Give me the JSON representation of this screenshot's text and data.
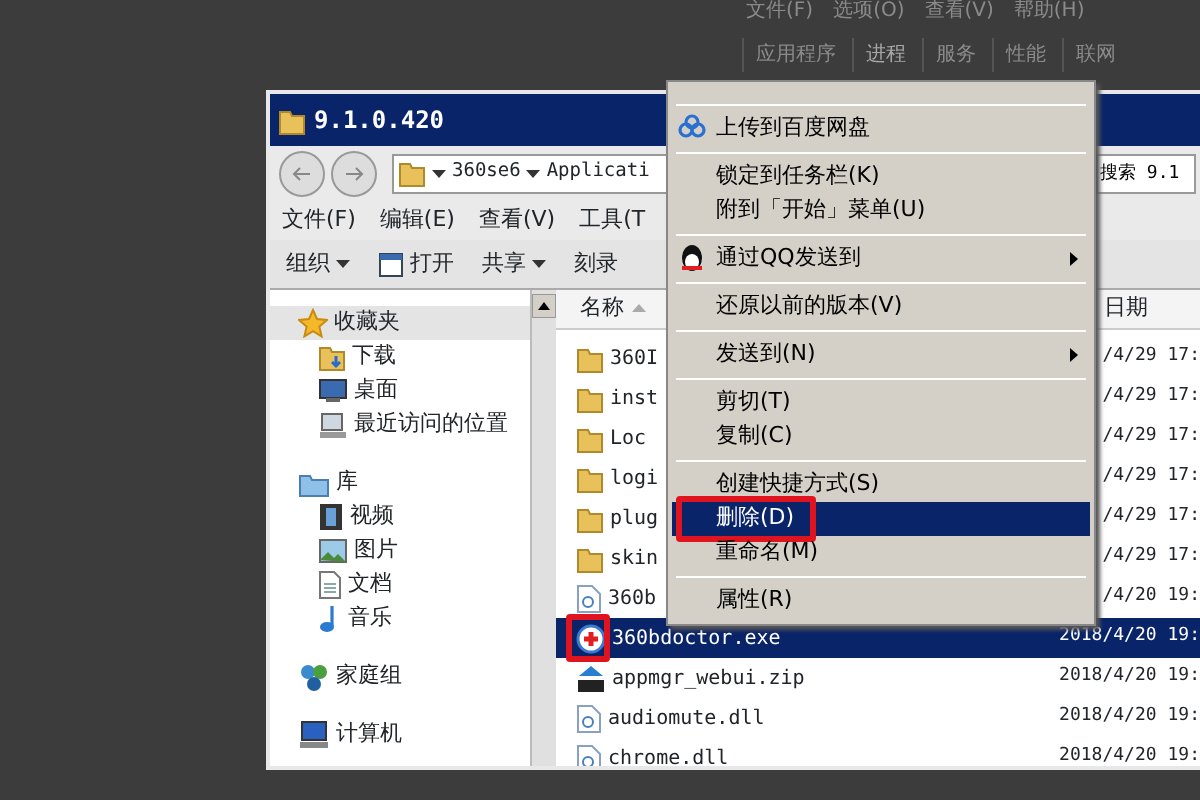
{
  "background_window": {
    "menu": [
      "文件(F)",
      "选项(O)",
      "查看(V)",
      "帮助(H)"
    ],
    "tabs": [
      {
        "label": "应用程序",
        "selected": false
      },
      {
        "label": "进程",
        "selected": true
      },
      {
        "label": "服务",
        "selected": false
      },
      {
        "label": "性能",
        "selected": false
      },
      {
        "label": "联网",
        "selected": false
      }
    ]
  },
  "window": {
    "title": "9.1.0.420",
    "address": [
      "360se6",
      "Applicati"
    ],
    "search": {
      "placeholder": "搜索 9.1"
    },
    "menu": [
      "文件(F)",
      "编辑(E)",
      "查看(V)",
      "工具(T"
    ],
    "toolbar": [
      {
        "kind": "menu",
        "label": "组织"
      },
      {
        "kind": "open",
        "label": "打开"
      },
      {
        "kind": "menu",
        "label": "共享"
      },
      {
        "kind": "plain",
        "label": "刻录"
      }
    ],
    "nav": [
      {
        "kind": "star",
        "label": "收藏夹",
        "selected": true,
        "children": [
          {
            "kind": "download",
            "label": "下载",
            "selected": false
          },
          {
            "kind": "desktop",
            "label": "桌面",
            "selected": false
          },
          {
            "kind": "recent",
            "label": "最近访问的位置",
            "selected": false
          }
        ]
      },
      {
        "kind": "library",
        "label": "库",
        "selected": false,
        "children": [
          {
            "kind": "video",
            "label": "视频",
            "selected": false
          },
          {
            "kind": "picture",
            "label": "图片",
            "selected": false
          },
          {
            "kind": "document",
            "label": "文档",
            "selected": false
          },
          {
            "kind": "music",
            "label": "音乐",
            "selected": false
          }
        ]
      },
      {
        "kind": "homegroup",
        "label": "家庭组",
        "selected": false
      },
      {
        "kind": "computer",
        "label": "计算机",
        "selected": false
      }
    ],
    "columns": [
      "名称",
      "日期"
    ],
    "rows": [
      {
        "kind": "folder",
        "name": "360I",
        "date": "/4/29 17:",
        "selected": false,
        "marked": false
      },
      {
        "kind": "folder",
        "name": "inst",
        "date": "/4/29 17:",
        "selected": false,
        "marked": false
      },
      {
        "kind": "folder",
        "name": "Loc",
        "date": "/4/29 17:",
        "selected": false,
        "marked": false
      },
      {
        "kind": "folder",
        "name": "logi",
        "date": "/4/29 17:",
        "selected": false,
        "marked": false
      },
      {
        "kind": "folder",
        "name": "plug",
        "date": "/4/29 17:",
        "selected": false,
        "marked": false
      },
      {
        "kind": "folder",
        "name": "skin",
        "date": "/4/29 17:",
        "selected": false,
        "marked": false
      },
      {
        "kind": "file",
        "name": "360b",
        "date": "/4/20 19:",
        "selected": false,
        "marked": false
      },
      {
        "kind": "exe",
        "name": "360bdoctor.exe",
        "date": "2018/4/20 19:",
        "selected": true,
        "marked": true
      },
      {
        "kind": "zip",
        "name": "appmgr_webui.zip",
        "date": "2018/4/20 19:",
        "selected": false,
        "marked": false
      },
      {
        "kind": "file",
        "name": "audiomute.dll",
        "date": "2018/4/20 19:",
        "selected": false,
        "marked": false
      },
      {
        "kind": "file",
        "name": "chrome.dll",
        "date": "2018/4/20 19:",
        "selected": false,
        "marked": false
      }
    ]
  },
  "context_menu": [
    {
      "kind": "separator"
    },
    {
      "kind": "item",
      "label": "上传到百度网盘",
      "submenu": false,
      "selected": false,
      "marked": false
    },
    {
      "kind": "separator"
    },
    {
      "kind": "item",
      "label": "锁定到任务栏(K)",
      "submenu": false,
      "selected": false,
      "marked": false
    },
    {
      "kind": "item",
      "label": "附到「开始」菜单(U)",
      "submenu": false,
      "selected": false,
      "marked": false
    },
    {
      "kind": "separator"
    },
    {
      "kind": "item",
      "label": "通过QQ发送到",
      "submenu": true,
      "selected": false,
      "marked": false
    },
    {
      "kind": "separator"
    },
    {
      "kind": "item",
      "label": "还原以前的版本(V)",
      "submenu": false,
      "selected": false,
      "marked": false
    },
    {
      "kind": "separator"
    },
    {
      "kind": "item",
      "label": "发送到(N)",
      "submenu": true,
      "selected": false,
      "marked": false
    },
    {
      "kind": "separator"
    },
    {
      "kind": "item",
      "label": "剪切(T)",
      "submenu": false,
      "selected": false,
      "marked": false
    },
    {
      "kind": "item",
      "label": "复制(C)",
      "submenu": false,
      "selected": false,
      "marked": false
    },
    {
      "kind": "separator"
    },
    {
      "kind": "item",
      "label": "创建快捷方式(S)",
      "submenu": false,
      "selected": false,
      "marked": false
    },
    {
      "kind": "item",
      "label": "删除(D)",
      "submenu": false,
      "selected": true,
      "marked": true
    },
    {
      "kind": "item",
      "label": "重命名(M)",
      "submenu": false,
      "selected": false,
      "marked": false
    },
    {
      "kind": "separator"
    },
    {
      "kind": "item",
      "label": "属性(R)",
      "submenu": false,
      "selected": false,
      "marked": false
    }
  ]
}
